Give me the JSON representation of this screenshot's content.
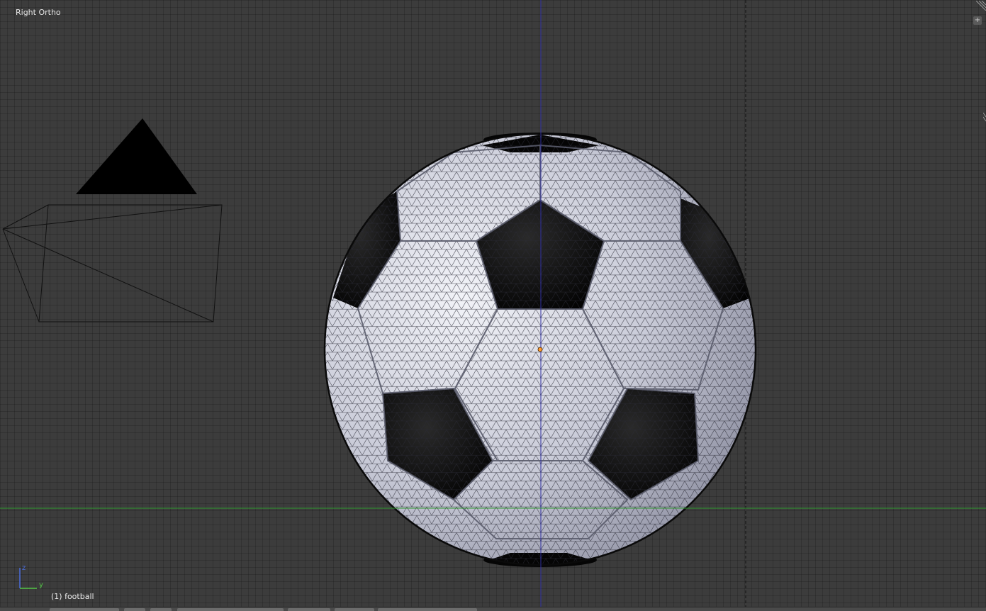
{
  "viewport": {
    "view_name": "Right Ortho",
    "active_object": "(1) football"
  },
  "axis_widget": {
    "vertical_axis": "z",
    "horizontal_axis": "y",
    "vertical_color": "#4a6bd8",
    "horizontal_color": "#54c846"
  },
  "scene_objects": {
    "lamp": "lamp-icon",
    "camera": "camera-icon",
    "mesh": "football"
  },
  "colors": {
    "background": "#3c3c3c",
    "z_axis_line": "#2f2fa0",
    "y_axis_line": "#2e9a2e",
    "origin_dot": "#ff9a2e",
    "wire": "#111111",
    "white_panel": "#d9dbe6",
    "black_panel": "#0a0a0a"
  },
  "icons": {
    "add": "plus-icon",
    "split": "hatch-icon"
  },
  "corner_plus_glyph": "+"
}
